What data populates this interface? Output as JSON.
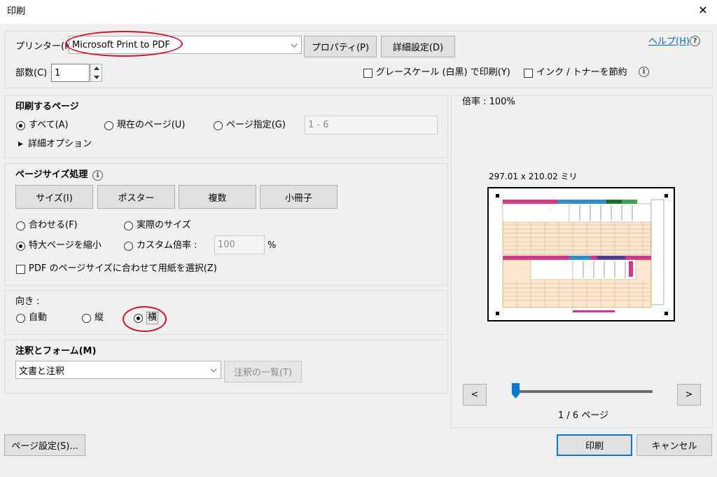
{
  "window": {
    "title": "印刷",
    "close_glyph": "✕"
  },
  "printer": {
    "label": "プリンター(N) :",
    "selected": "Microsoft Print to PDF",
    "properties_button": "プロパティ(P)",
    "advanced_button": "詳細設定(D)",
    "help_link": "ヘルプ(H)",
    "help_glyph": "?"
  },
  "copies": {
    "label": "部数(C) :",
    "value": "1"
  },
  "grayscale": {
    "label": "グレースケール (白黒) で印刷(Y)",
    "checked": false
  },
  "save_ink": {
    "label": "インク / トナーを節約",
    "checked": false
  },
  "info_glyph": "i",
  "pages_section": {
    "title": "印刷するページ",
    "all": "すべて(A)",
    "current": "現在のページ(U)",
    "range": "ページ指定(G)",
    "range_value": "1 - 6",
    "more_options": "詳細オプション",
    "more_glyph": "▶"
  },
  "page_sizing": {
    "title": "ページサイズ処理",
    "buttons": [
      "サイズ(I)",
      "ポスター",
      "複数",
      "小冊子"
    ],
    "fit": "合わせる(F)",
    "actual": "実際のサイズ",
    "shrink": "特大ページを縮小",
    "custom": "カスタム倍率 :",
    "custom_value": "100",
    "percent": "%",
    "pdf_paper": "PDF のページサイズに合わせて用紙を選択(Z)"
  },
  "orientation": {
    "title": "向き :",
    "auto": "自動",
    "portrait": "縦",
    "landscape": "横",
    "selected": "landscape"
  },
  "comments": {
    "title": "注釈とフォーム(M)",
    "selected": "文書と注釈",
    "summarize_button": "注釈の一覧(T)"
  },
  "preview": {
    "zoom": "倍率 : 100%",
    "size": "297.01 x 210.02 ミリ",
    "prev": "<",
    "next": ">",
    "page_indicator": "1 / 6 ページ",
    "slider_position": 0.0
  },
  "footer": {
    "page_setup": "ページ設定(S)...",
    "print": "印刷",
    "cancel": "キャンセル"
  },
  "colors": {
    "accent": "#0078d7",
    "annotation_red": "#d2122e",
    "form_orange": "#f3d4b0"
  }
}
